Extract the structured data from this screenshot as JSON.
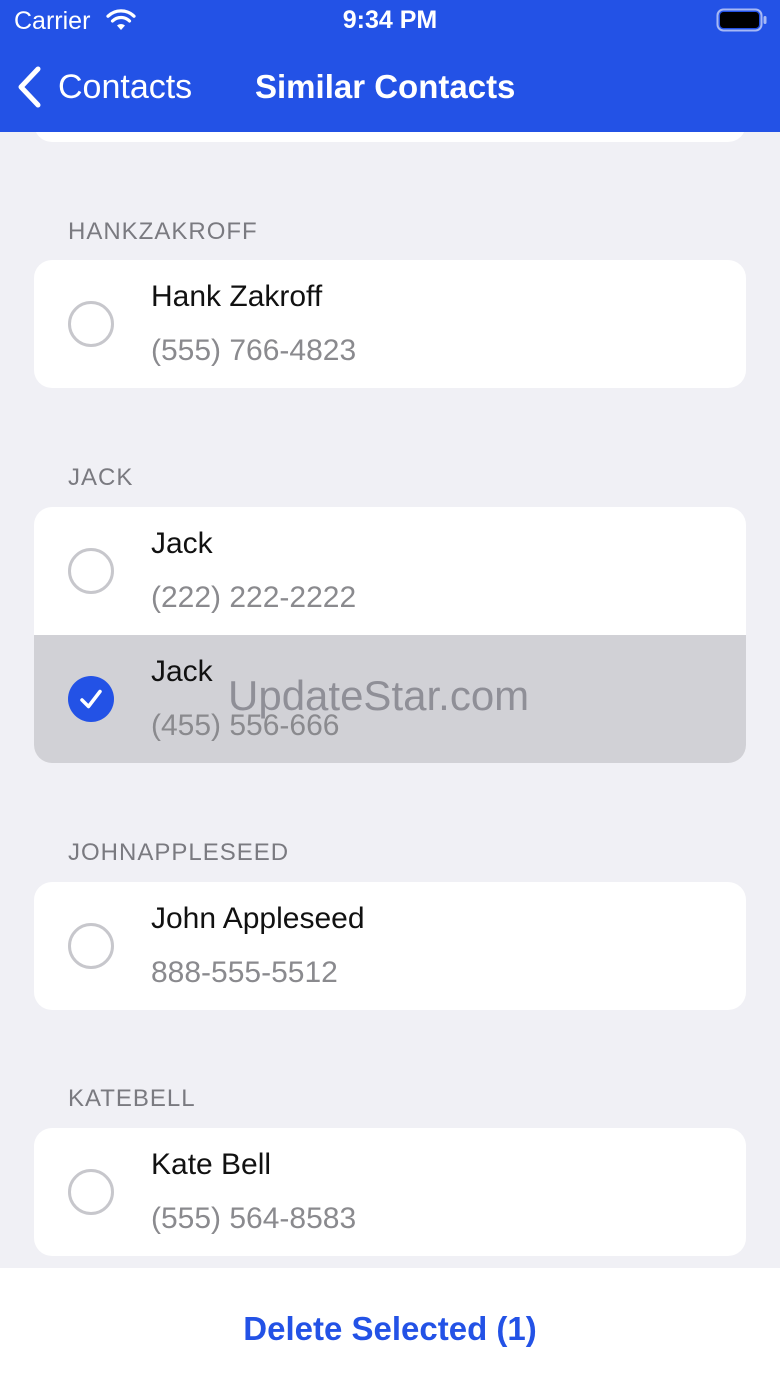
{
  "status_bar": {
    "carrier": "Carrier",
    "time": "9:34 PM"
  },
  "nav": {
    "back_label": "Contacts",
    "title": "Similar Contacts"
  },
  "colors": {
    "accent": "#2352e6",
    "background": "#f0f0f5",
    "selected_row": "#d1d1d6"
  },
  "sections": [
    {
      "header": "HANKZAKROFF",
      "contacts": [
        {
          "name": "Hank Zakroff",
          "phone": "(555) 766-4823",
          "selected": false
        }
      ]
    },
    {
      "header": "JACK",
      "contacts": [
        {
          "name": "Jack",
          "phone": "(222) 222-2222",
          "selected": false
        },
        {
          "name": "Jack",
          "phone": "(455) 556-666",
          "selected": true
        }
      ]
    },
    {
      "header": "JOHNAPPLESEED",
      "contacts": [
        {
          "name": "John Appleseed",
          "phone": "888-555-5512",
          "selected": false
        }
      ]
    },
    {
      "header": "KATEBELL",
      "contacts": [
        {
          "name": "Kate Bell",
          "phone": "(555) 564-8583",
          "selected": false
        }
      ]
    }
  ],
  "watermark": "UpdateStar.com",
  "footer": {
    "delete_label": "Delete Selected (1)"
  }
}
